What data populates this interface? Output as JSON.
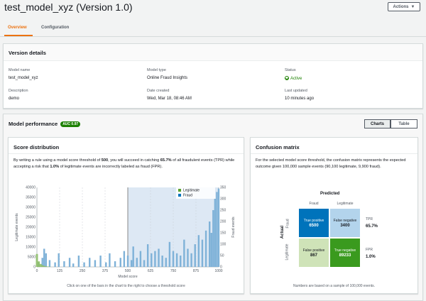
{
  "header": {
    "title": "test_model_xyz (Version 1.0)",
    "actions_label": "Actions"
  },
  "tabs": [
    {
      "label": "Overview"
    },
    {
      "label": "Configuration"
    }
  ],
  "version_details": {
    "title": "Version details",
    "model_name_label": "Model name",
    "model_name": "test_model_xyz",
    "model_type_label": "Model type",
    "model_type": "Online Fraud Insights",
    "status_label": "Status",
    "status": "Active",
    "description_label": "Description",
    "description": "demo",
    "date_created_label": "Date created",
    "date_created": "Wed, Mar 18, 08:46 AM",
    "last_updated_label": "Last updated",
    "last_updated": "10 minutes ago"
  },
  "performance": {
    "title": "Model performance",
    "auc_badge": "AUC 0.97",
    "charts_label": "Charts",
    "table_label": "Table"
  },
  "score_distribution": {
    "title": "Score distribution",
    "desc_pre": "By writing a rule using a model score threshold of ",
    "threshold": "500",
    "desc_mid": ", you will succeed in catching ",
    "tpr": "65.7%",
    "desc_mid2": " of all fraudulent events (TPR) while accepting a risk that ",
    "fpr": "1.0%",
    "desc_post": " of legitimate events are incorrectly labeled as fraud (FPR).",
    "footnote": "Click on one of the bars in the chart to the right to choose a threshold score"
  },
  "chart_data": {
    "type": "bar",
    "xlabel": "Model score",
    "ylabel_left": "Legitimate events",
    "ylabel_right": "Fraud events",
    "xlim": [
      0,
      1000
    ],
    "ylim_left": [
      0,
      40000
    ],
    "ylim_right": [
      0,
      350
    ],
    "x_ticks": [
      0,
      125,
      250,
      375,
      500,
      625,
      750,
      875,
      1000
    ],
    "y_ticks_left": [
      0,
      5000,
      10000,
      15000,
      20000,
      25000,
      30000,
      35000,
      40000
    ],
    "y_ticks_right": [
      0,
      50,
      100,
      150,
      200,
      250,
      300,
      350
    ],
    "threshold": 500,
    "series": [
      {
        "name": "Legitimate",
        "color": "#8fbf6a",
        "x": [
          0,
          10,
          20,
          30,
          40,
          50,
          60,
          70
        ],
        "values": [
          6500,
          2800,
          1500,
          900,
          500,
          300,
          200,
          100
        ]
      },
      {
        "name": "Fraud",
        "color": "#7fb2d8",
        "x": [
          10,
          30,
          40,
          50,
          70,
          100,
          120,
          150,
          180,
          200,
          230,
          260,
          290,
          320,
          350,
          380,
          400,
          430,
          460,
          480,
          500,
          520,
          530,
          550,
          570,
          590,
          610,
          630,
          650,
          670,
          690,
          710,
          730,
          750,
          770,
          790,
          810,
          830,
          850,
          870,
          890,
          910,
          930,
          950,
          960,
          970,
          980,
          990,
          1000
        ],
        "values": [
          20,
          40,
          80,
          60,
          30,
          20,
          60,
          25,
          40,
          15,
          50,
          20,
          40,
          30,
          50,
          20,
          60,
          25,
          40,
          70,
          50,
          30,
          90,
          40,
          70,
          30,
          100,
          60,
          70,
          80,
          50,
          40,
          110,
          70,
          60,
          50,
          120,
          80,
          60,
          100,
          140,
          120,
          160,
          200,
          150,
          250,
          300,
          330,
          345
        ]
      }
    ]
  },
  "confusion": {
    "title": "Confusion matrix",
    "desc": "For the selected model score threshold, the confusion matrix represents the expected outcome given 100,000 sample events (90,100 legitimate, 9,900 fraud).",
    "predicted_label": "Predicted",
    "actual_label": "Actual",
    "col_fraud": "Fraud",
    "col_legit": "Legitimate",
    "row_fraud": "Fraud",
    "row_legit": "Legitimate",
    "tp_label": "True positive",
    "tp": "6500",
    "fn_label": "False negative",
    "fn": "3400",
    "fp_label": "False positive",
    "fp": "867",
    "tn_label": "True negative",
    "tn": "89233",
    "tpr_label": "TPR",
    "tpr": "65.7%",
    "fpr_label": "FPR",
    "fpr": "1.0%",
    "footnote": "Numbers are based on a sample of 100,000 events.",
    "colors": {
      "tp": "#0073bb",
      "fn": "#b3d4ec",
      "fp": "#cfe3b8",
      "tn": "#3a9a1e"
    }
  }
}
